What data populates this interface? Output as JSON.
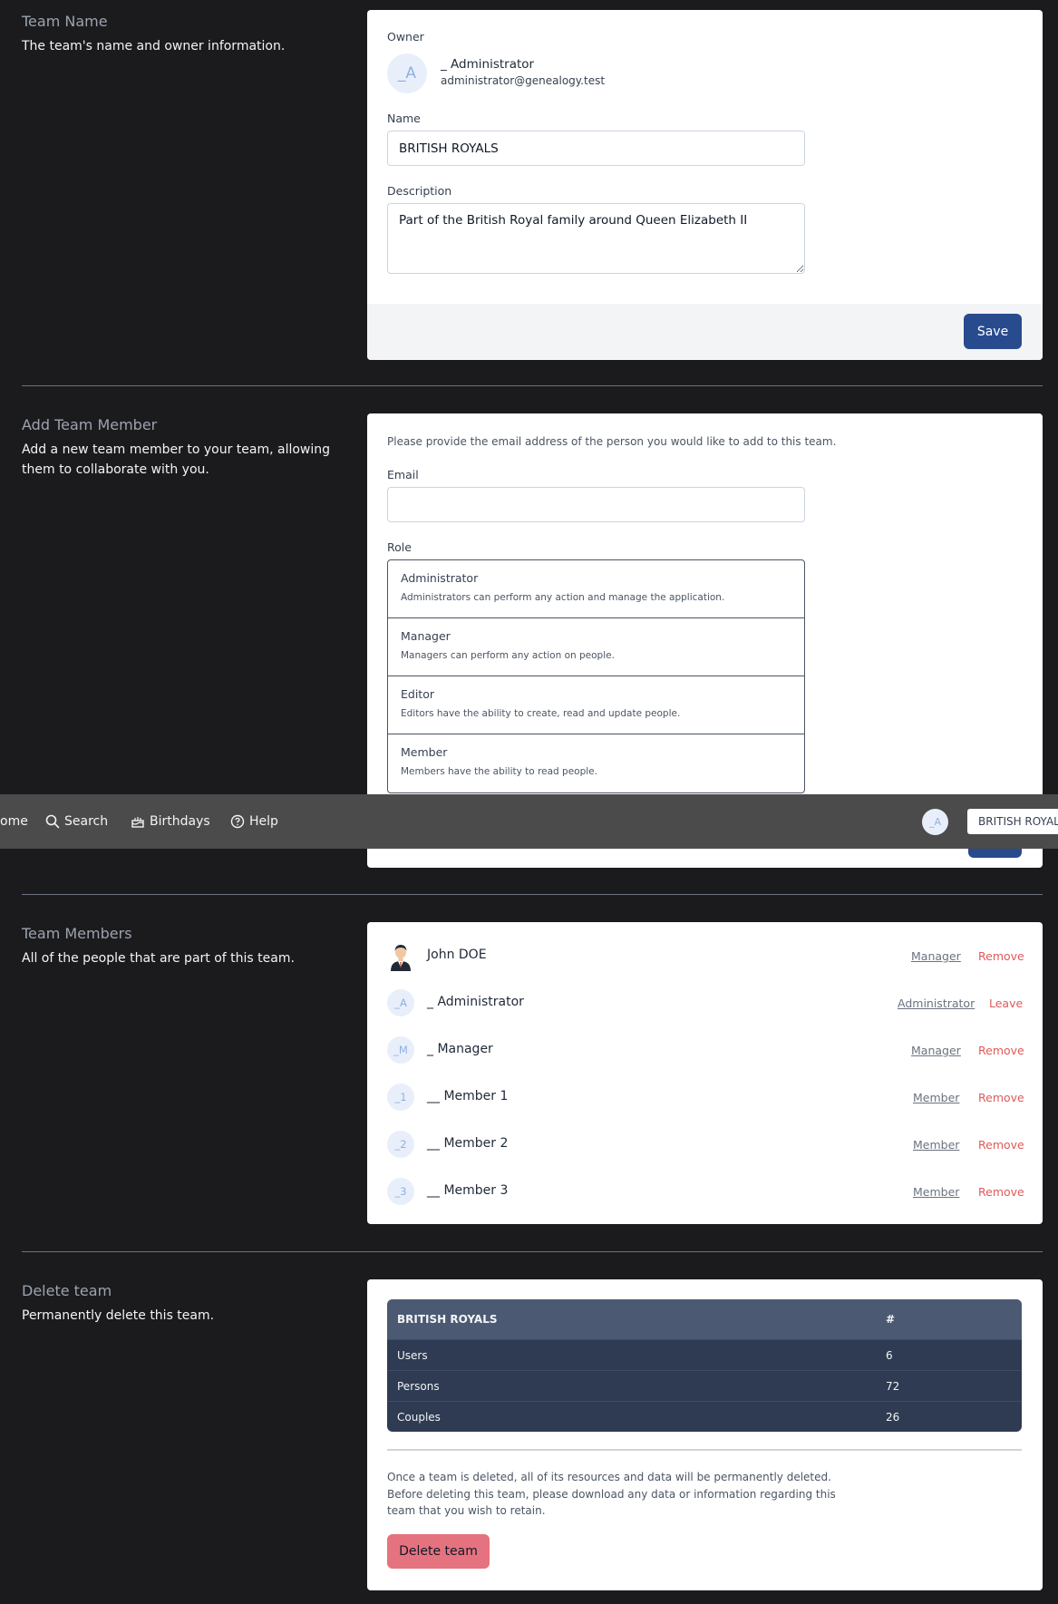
{
  "team_name_section": {
    "title": "Team Name",
    "description": "The team's name and owner information.",
    "owner_label": "Owner",
    "owner_avatar": "_A",
    "owner_name": "_ Administrator",
    "owner_email": "administrator@genealogy.test",
    "name_label": "Name",
    "name_value": "BRITISH ROYALS",
    "description_label": "Description",
    "description_value": "Part of the British Royal family around Queen Elizabeth II",
    "save_label": "Save"
  },
  "add_member_section": {
    "title": "Add Team Member",
    "description": "Add a new team member to your team, allowing them to collaborate with you.",
    "intro": "Please provide the email address of the person you would like to add to this team.",
    "email_label": "Email",
    "email_value": "",
    "role_label": "Role",
    "roles": [
      {
        "name": "Administrator",
        "desc": "Administrators can perform any action and manage the application."
      },
      {
        "name": "Manager",
        "desc": "Managers can perform any action on people."
      },
      {
        "name": "Editor",
        "desc": "Editors have the ability to create, read and update people."
      },
      {
        "name": "Member",
        "desc": "Members have the ability to read people."
      }
    ]
  },
  "navbar": {
    "items": [
      "ome",
      "Search",
      "Birthdays",
      "Help"
    ],
    "avatar": "_A",
    "team_selector": "BRITISH ROYALS"
  },
  "members_section": {
    "title": "Team Members",
    "description": "All of the people that are part of this team.",
    "members": [
      {
        "avatar": "",
        "name": "John DOE",
        "role": "Manager",
        "action": "Remove"
      },
      {
        "avatar": "_A",
        "name": "_ Administrator",
        "role": "Administrator",
        "action": "Leave"
      },
      {
        "avatar": "_M",
        "name": "_ Manager",
        "role": "Manager",
        "action": "Remove"
      },
      {
        "avatar": "_1",
        "name": "__ Member 1",
        "role": "Member",
        "action": "Remove"
      },
      {
        "avatar": "_2",
        "name": "__ Member 2",
        "role": "Member",
        "action": "Remove"
      },
      {
        "avatar": "_3",
        "name": "__ Member 3",
        "role": "Member",
        "action": "Remove"
      }
    ]
  },
  "delete_section": {
    "title": "Delete team",
    "description": "Permanently delete this team.",
    "table_header": [
      "BRITISH ROYALS",
      "#"
    ],
    "table_rows": [
      [
        "Users",
        "6"
      ],
      [
        "Persons",
        "72"
      ],
      [
        "Couples",
        "26"
      ]
    ],
    "warning": "Once a team is deleted, all of its resources and data will be permanently deleted. Before deleting this team, please download any data or information regarding this team that you wish to retain.",
    "delete_label": "Delete team"
  },
  "colors": {
    "primary": "#284b8e",
    "danger": "#e5737f",
    "remove_text": "#e05a5a",
    "page_bg": "#1b1b1d",
    "navbar_bg": "#4b4b4b"
  }
}
